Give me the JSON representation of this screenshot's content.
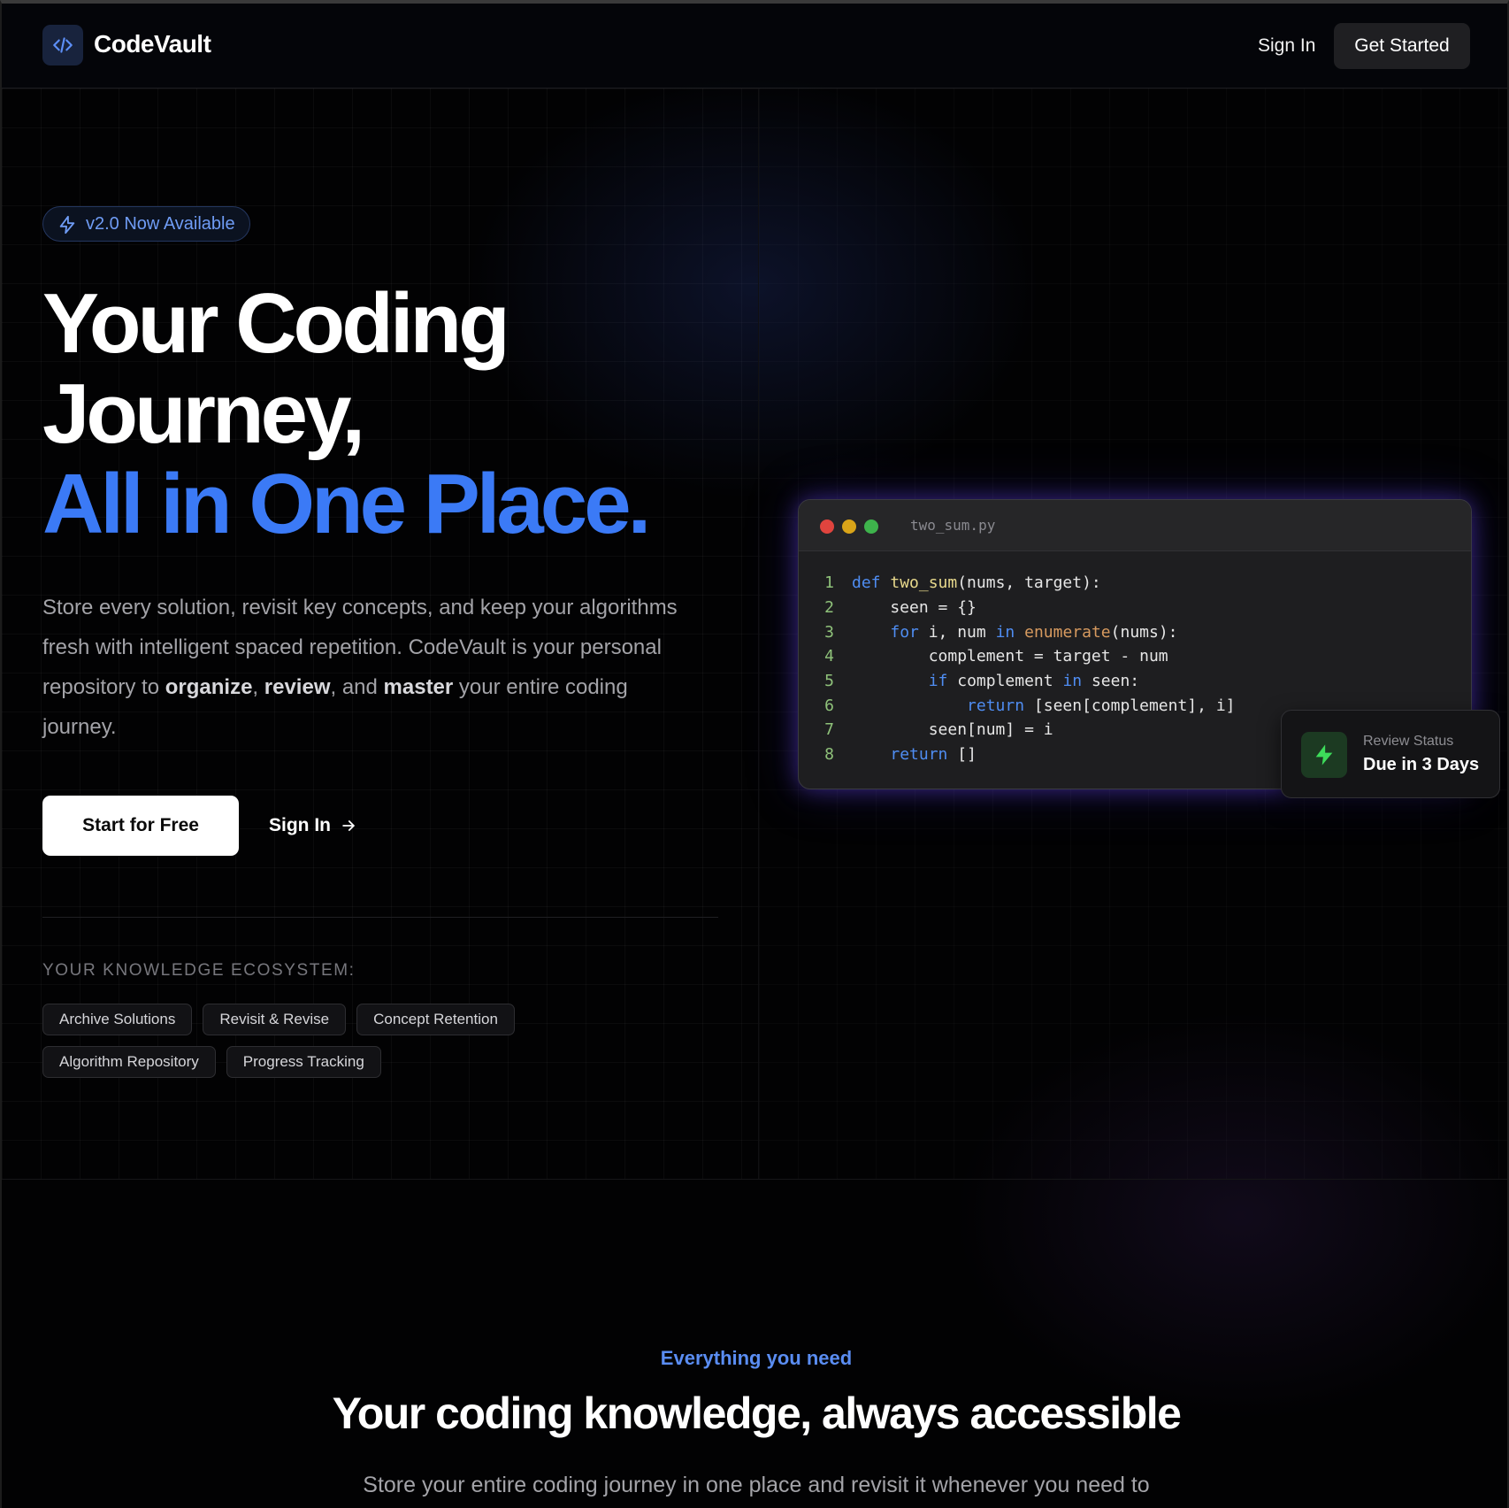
{
  "header": {
    "brand": "CodeVault",
    "nav_signin": "Sign In",
    "nav_get_started": "Get Started"
  },
  "hero": {
    "badge": "v2.0 Now Available",
    "title_line1": "Your Coding",
    "title_line2": "Journey,",
    "title_line3": "All in One Place.",
    "lead_part1": "Store every solution, revisit key concepts, and keep your algorithms fresh with intelligent spaced repetition. CodeVault is your personal repository to ",
    "lead_b1": "organize",
    "lead_sep1": ", ",
    "lead_b2": "review",
    "lead_sep2": ", and ",
    "lead_b3": "master",
    "lead_part2": " your entire coding journey.",
    "cta_primary": "Start for Free",
    "cta_secondary": "Sign In",
    "ecosystem_label": "YOUR KNOWLEDGE ECOSYSTEM:",
    "chips_row1": [
      "Archive Solutions",
      "Revisit & Revise",
      "Concept Retention"
    ],
    "chips_row2": [
      "Algorithm Repository",
      "Progress Tracking"
    ]
  },
  "code_window": {
    "file_name": "two_sum.py",
    "line_numbers": [
      "1",
      "2",
      "3",
      "4",
      "5",
      "6",
      "7",
      "8"
    ]
  },
  "review_card": {
    "title": "Review Status",
    "status": "Due in 3 Days"
  },
  "features": {
    "eyebrow": "Everything you need",
    "title": "Your coding knowledge, always accessible",
    "subtitle": "Store your entire coding journey in one place and revisit it whenever you need to"
  },
  "colors": {
    "accent_blue": "#3b7af6",
    "badge_text": "#6f9cf5",
    "review_green": "#3ddc5a",
    "glow_purple": "#6c46ff"
  }
}
